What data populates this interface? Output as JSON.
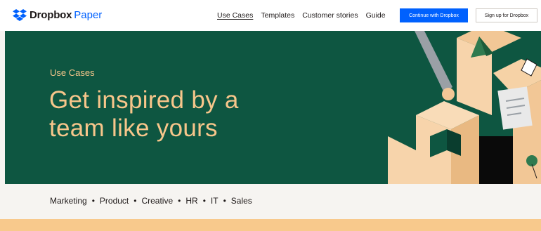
{
  "header": {
    "brand": "Dropbox",
    "product": "Paper",
    "nav": [
      {
        "label": "Use Cases",
        "active": true
      },
      {
        "label": "Templates",
        "active": false
      },
      {
        "label": "Customer stories",
        "active": false
      },
      {
        "label": "Guide",
        "active": false
      }
    ],
    "primary_button": "Continue with Dropbox",
    "secondary_button": "Sign up for Dropbox",
    "brand_color": "#0061fe"
  },
  "hero": {
    "eyebrow": "Use Cases",
    "title_line1": "Get inspired by a",
    "title_line2": "team like yours",
    "background_color": "#0e5641",
    "text_color": "#f7c68b"
  },
  "categories": {
    "items": [
      "Marketing",
      "Product",
      "Creative",
      "HR",
      "IT",
      "Sales"
    ],
    "separator": "•"
  },
  "icons": {
    "logo": "dropbox-logo-icon",
    "illustration": "hero-illustration"
  }
}
